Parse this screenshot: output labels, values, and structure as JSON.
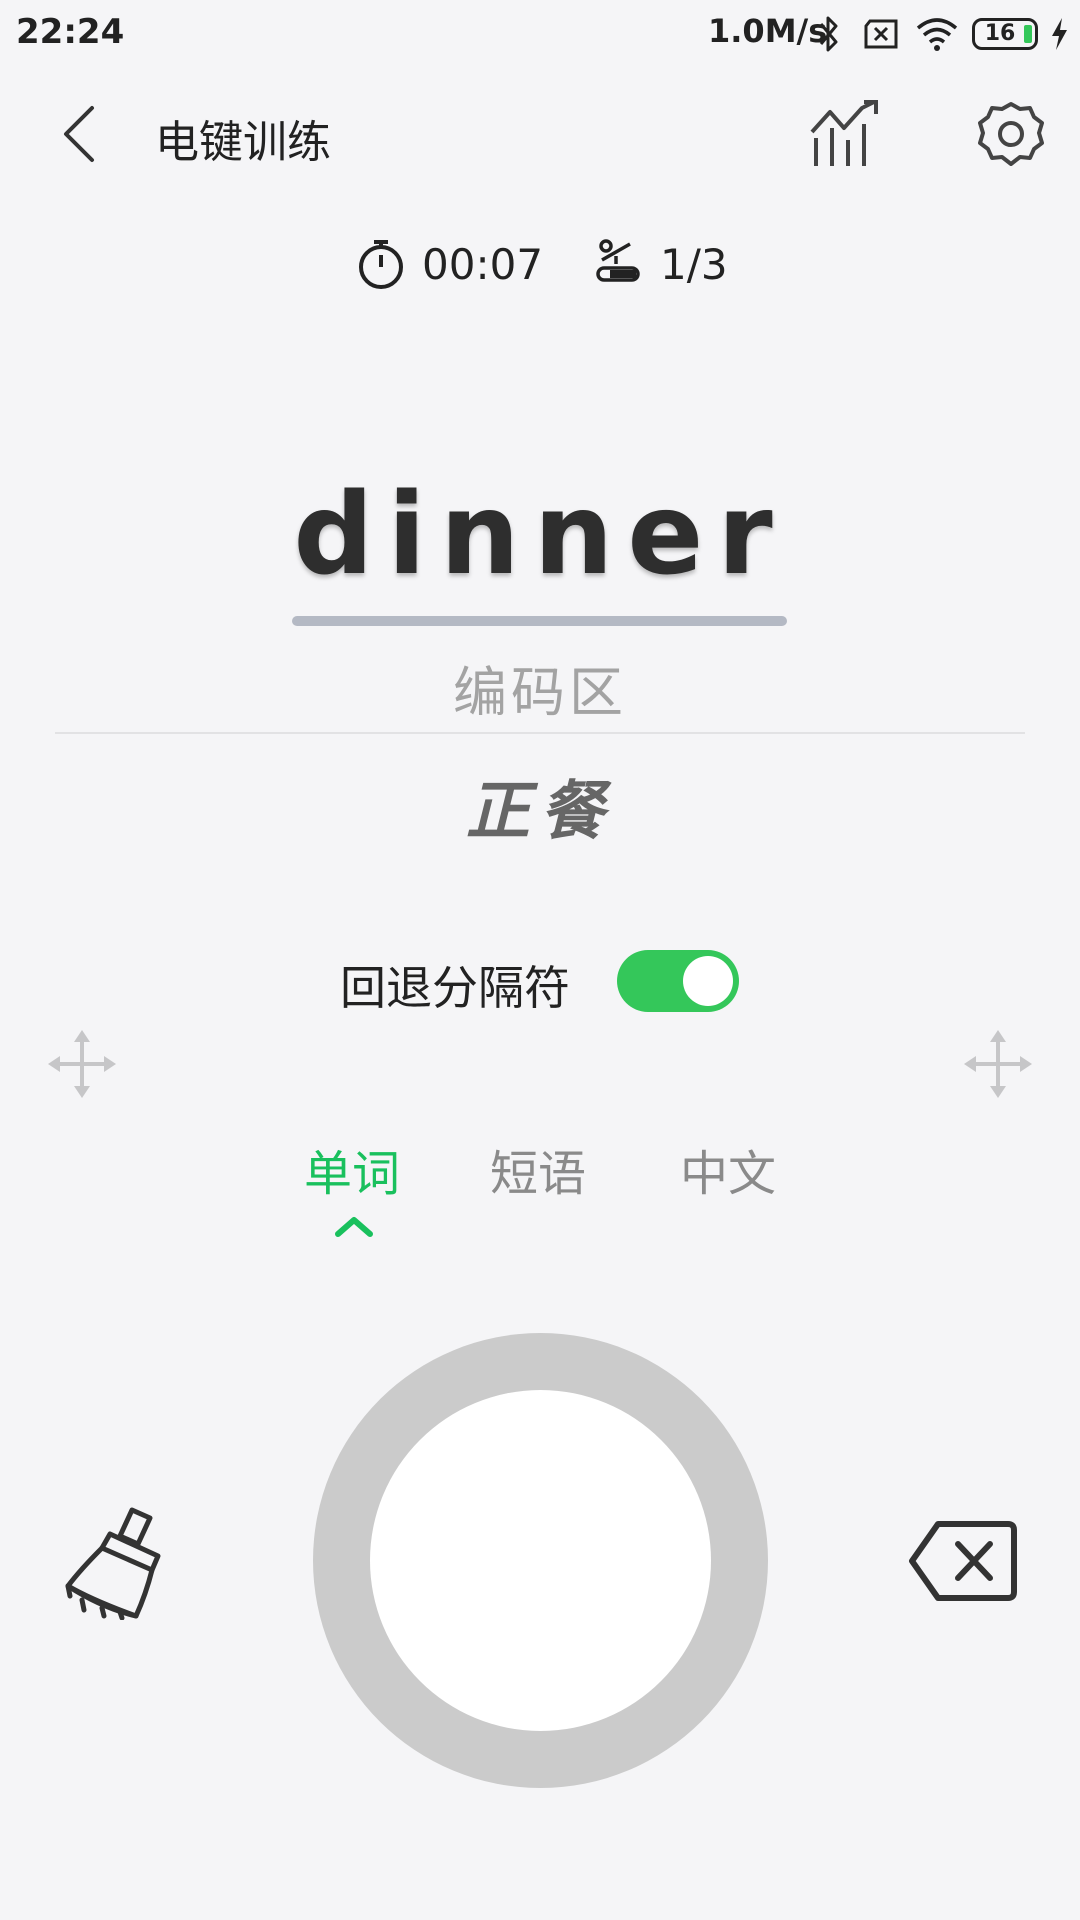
{
  "status_bar": {
    "time": "22:24",
    "speed": "1.0M/s",
    "battery": "16",
    "icons": [
      "bluetooth-icon",
      "sim-error-icon",
      "wifi-icon",
      "battery-icon",
      "charging-icon"
    ]
  },
  "header": {
    "title": "电键训练",
    "icons": [
      "back-icon",
      "stats-icon",
      "settings-icon"
    ]
  },
  "meta": {
    "elapsed_time": "00:07",
    "progress": "1/3"
  },
  "practice": {
    "word": "dinner",
    "code_area_label": "编码区",
    "translation": "正餐"
  },
  "backspace_separator": {
    "label": "回退分隔符",
    "enabled": true
  },
  "tabs": [
    {
      "label": "单词",
      "active": true
    },
    {
      "label": "短语",
      "active": false
    },
    {
      "label": "中文",
      "active": false
    }
  ],
  "colors": {
    "accent": "#19c05d",
    "toggle_on": "#34c75a",
    "background": "#f5f5f7",
    "dial_ring": "#cbcbcb"
  }
}
